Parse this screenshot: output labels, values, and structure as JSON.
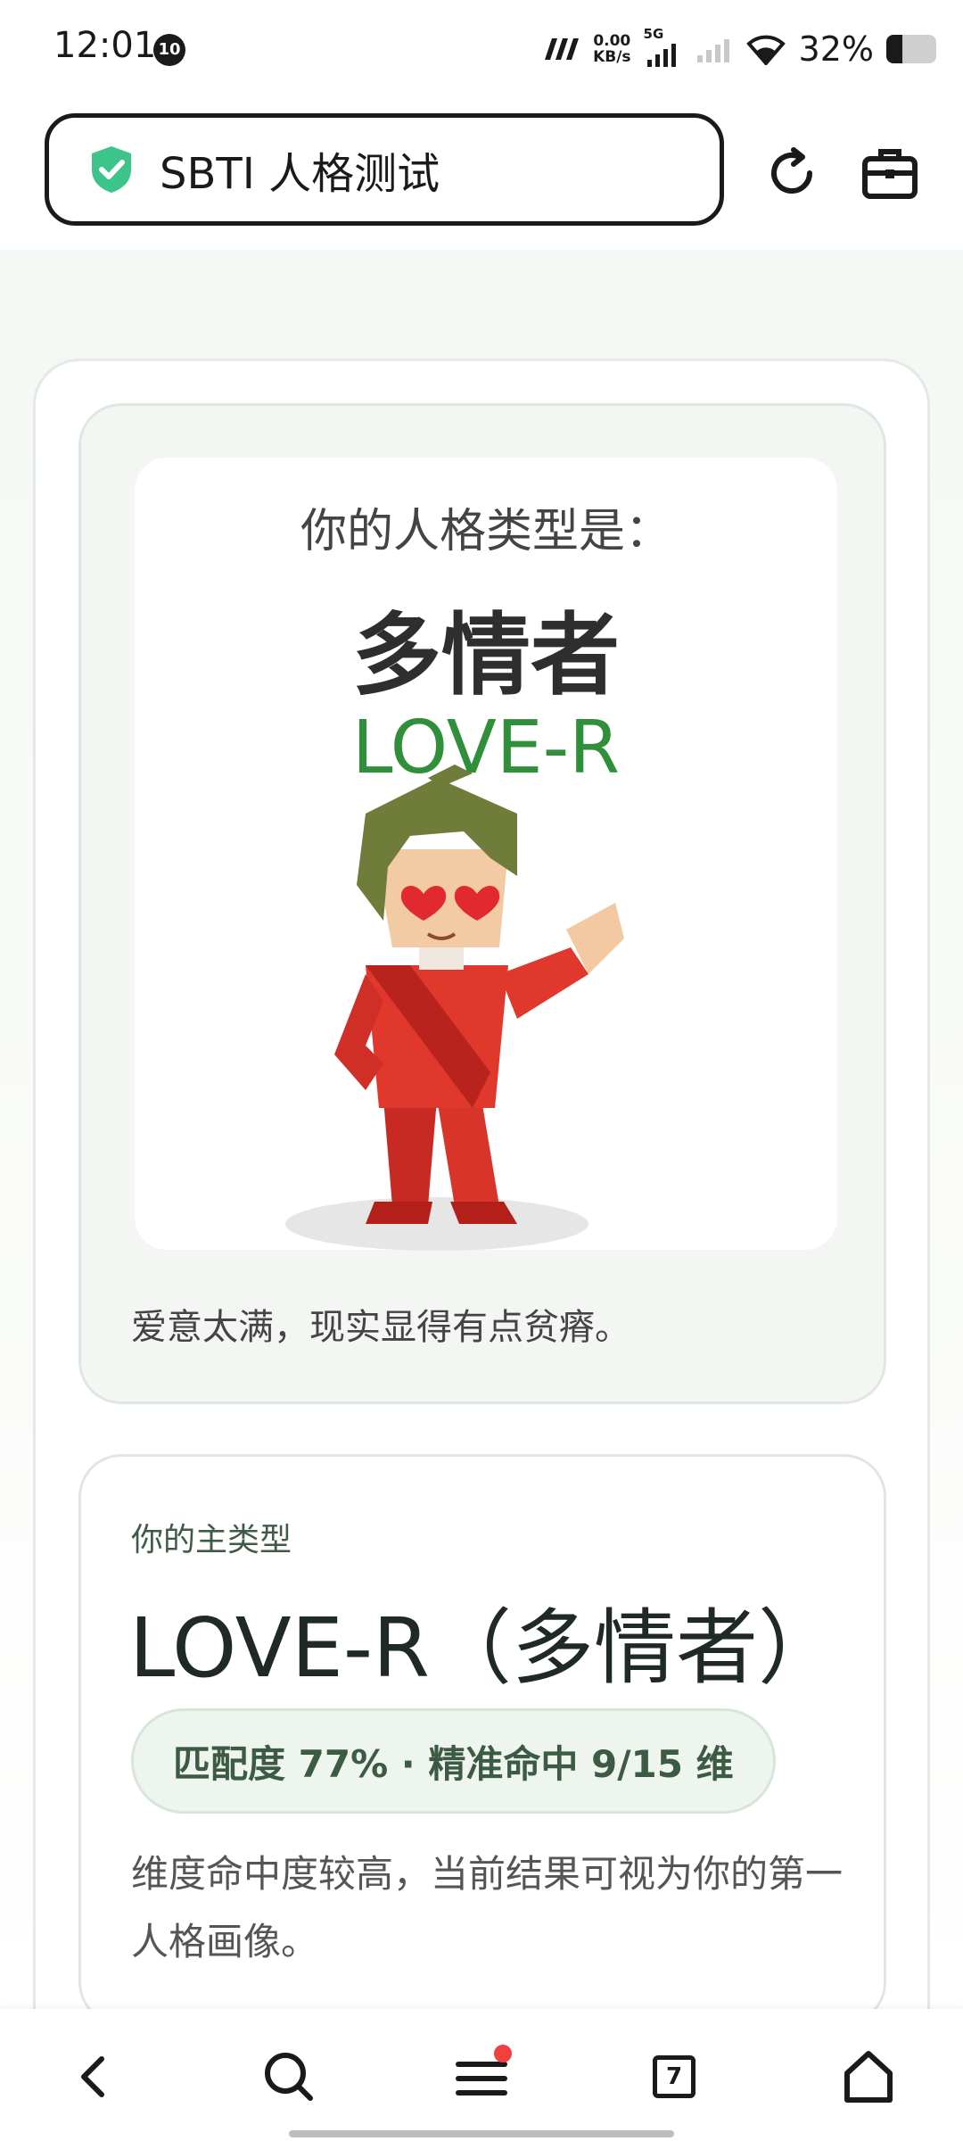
{
  "status_bar": {
    "time": "12:01",
    "notification_badge": "10",
    "net_speed_value": "0.00",
    "net_speed_unit": "KB/s",
    "network_type": "5G",
    "battery_text": "32%",
    "battery_level_percent": 32
  },
  "browser": {
    "url_title": "SBTI 人格测试",
    "tab_count": "7"
  },
  "hero": {
    "subtitle": "你的人格类型是：",
    "type_name": "多情者",
    "type_code": "LOVE-R",
    "description": "爱意太满，现实显得有点贫瘠。"
  },
  "main_type": {
    "label": "你的主类型",
    "title": "LOVE-R（多情者）",
    "match_text": "匹配度 77% · 精准命中 9/15 维",
    "description": "维度命中度较高，当前结果可视为你的第一人格画像。"
  },
  "colors": {
    "accent_green": "#2f8f3a",
    "shield_green": "#3cc48a",
    "notification_dot": "#f04040"
  }
}
